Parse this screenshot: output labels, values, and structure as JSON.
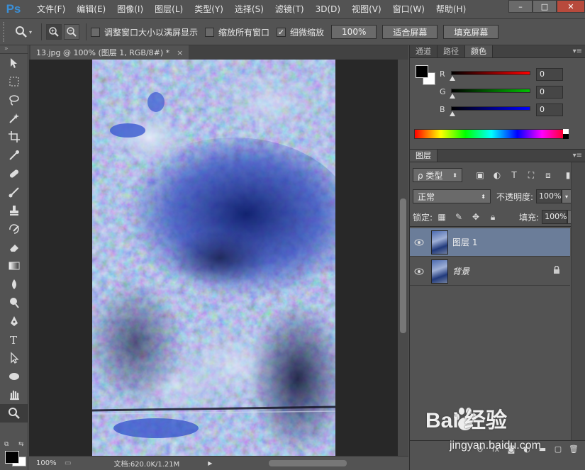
{
  "app": {
    "logo": "Ps"
  },
  "menu": [
    "文件(F)",
    "编辑(E)",
    "图像(I)",
    "图层(L)",
    "类型(Y)",
    "选择(S)",
    "滤镜(T)",
    "3D(D)",
    "视图(V)",
    "窗口(W)",
    "帮助(H)"
  ],
  "window_controls": {
    "minimize": "–",
    "maximize": "□",
    "close": "✕"
  },
  "options": {
    "resize_windows": {
      "label": "调整窗口大小以满屏显示",
      "checked": false
    },
    "zoom_all": {
      "label": "缩放所有窗口",
      "checked": false
    },
    "scrubby_zoom": {
      "label": "细微缩放",
      "checked": true
    },
    "btn_100": "100%",
    "btn_fit": "适合屏幕",
    "btn_fill": "填充屏幕"
  },
  "document": {
    "tab_title": "13.jpg @ 100% (图层 1, RGB/8#) *",
    "tab_close": "×",
    "zoom": "100%",
    "doc_info": "文档:620.0K/1.21M"
  },
  "color_panel": {
    "tabs": [
      "通道",
      "路径",
      "颜色"
    ],
    "active_tab": "颜色",
    "channels": [
      {
        "label": "R",
        "value": "0",
        "color": "#ff0000"
      },
      {
        "label": "G",
        "value": "0",
        "color": "#00c000"
      },
      {
        "label": "B",
        "value": "0",
        "color": "#0000ff"
      }
    ],
    "foreground": "#000000",
    "background": "#ffffff"
  },
  "layers_panel": {
    "tab": "图层",
    "filter_kind": "ρ 类型",
    "blend_mode": "正常",
    "opacity_label": "不透明度:",
    "opacity": "100%",
    "lock_label": "锁定:",
    "fill_label": "填充:",
    "fill": "100%",
    "layers": [
      {
        "name": "图层 1",
        "selected": true,
        "locked": false,
        "italic": false
      },
      {
        "name": "背景",
        "selected": false,
        "locked": true,
        "italic": true
      }
    ],
    "footer_fx": "fx"
  },
  "watermark": {
    "brand": "Bai 经验",
    "url": "jingyan.baidu.com"
  }
}
